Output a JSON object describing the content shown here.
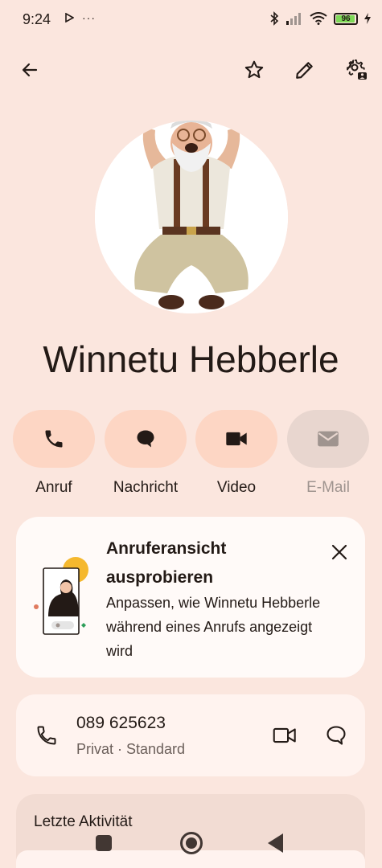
{
  "status_bar": {
    "time": "9:24",
    "left_icons": [
      "play-store-notification-icon",
      "more-notifications-icon"
    ],
    "more_glyph": "···",
    "battery_level": "96",
    "right_icons": [
      "bluetooth-icon",
      "signal-icon",
      "wifi-icon",
      "battery-icon",
      "charging-icon"
    ]
  },
  "top_bar": {
    "icons": [
      "back-arrow-icon",
      "star-outline-icon",
      "pencil-icon",
      "contact-settings-icon"
    ]
  },
  "contact": {
    "name": "Winnetu Hebberle",
    "avatar": "avatar-photo-jumping-old-man"
  },
  "actions": [
    {
      "label": "Anruf",
      "icon": "phone-icon",
      "enabled": true
    },
    {
      "label": "Nachricht",
      "icon": "message-icon",
      "enabled": true
    },
    {
      "label": "Video",
      "icon": "video-camera-icon",
      "enabled": true
    },
    {
      "label": "E-Mail",
      "icon": "mail-icon",
      "enabled": false
    }
  ],
  "promo": {
    "title": "Anruferansicht ausprobieren",
    "body": "Anpassen, wie Winnetu Hebberle während eines Anrufs angezeigt wird",
    "close_icon": "close-icon"
  },
  "phone_entry": {
    "number": "089 625623",
    "meta": "Privat · Standard",
    "icons": [
      "phone-outline-icon",
      "video-outline-icon",
      "message-outline-icon"
    ]
  },
  "activity": {
    "title": "Letzte Aktivität"
  },
  "colors": {
    "background": "#fbe6de",
    "action_pill": "#fdd6c4",
    "action_pill_disabled": "#e8d6cf",
    "card": "#fffaf8",
    "text": "#231a16",
    "battery": "#7ed957",
    "accent_sun": "#f5b82e"
  }
}
